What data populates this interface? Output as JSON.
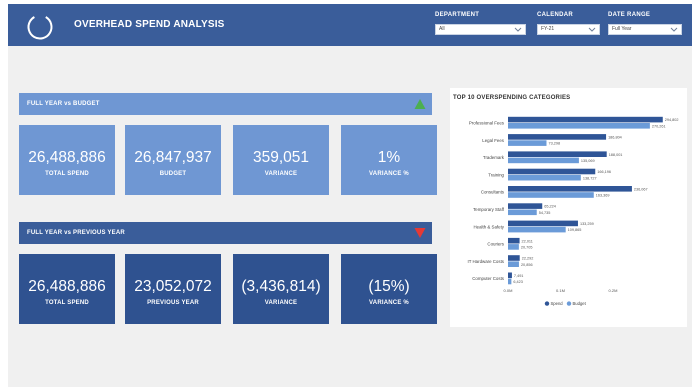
{
  "header": {
    "title": "OVERHEAD SPEND ANALYSIS",
    "filters": [
      {
        "label": "DEPARTMENT",
        "value": "All"
      },
      {
        "label": "CALENDAR",
        "value": "FY-21"
      },
      {
        "label": "DATE RANGE",
        "value": "Full Year"
      }
    ]
  },
  "sections": {
    "budget": {
      "title": "FULL YEAR vs BUDGET",
      "indicator": "up-arrow-green",
      "indicator_color": "#4caf50",
      "cards": [
        {
          "value": "26,488,886",
          "label": "TOTAL SPEND"
        },
        {
          "value": "26,847,937",
          "label": "BUDGET"
        },
        {
          "value": "359,051",
          "label": "VARIANCE"
        },
        {
          "value": "1%",
          "label": "VARIANCE %"
        }
      ]
    },
    "previous_year": {
      "title": "FULL YEAR vs PREVIOUS YEAR",
      "indicator": "down-arrow-red",
      "indicator_color": "#e53935",
      "cards": [
        {
          "value": "26,488,886",
          "label": "TOTAL SPEND"
        },
        {
          "value": "23,052,072",
          "label": "PREVIOUS YEAR"
        },
        {
          "value": "(3,436,814)",
          "label": "VARIANCE"
        },
        {
          "value": "(15%)",
          "label": "VARIANCE %"
        }
      ]
    }
  },
  "colors": {
    "header": "#3a5d9a",
    "light_card": "#6f97d3",
    "dark_card": "#2f5290",
    "spend": "#2f5597",
    "budget": "#6b9bd8"
  },
  "chart": {
    "title": "TOP 10 OVERSPENDING CATEGORIES"
  },
  "chart_data": {
    "type": "bar",
    "orientation": "horizontal",
    "title": "TOP 10 OVERSPENDING CATEGORIES",
    "categories": [
      "Professional Fees",
      "Legal Fees",
      "Trademark",
      "Training",
      "Consultants",
      "Temporary Staff",
      "Health & Safety",
      "Couriers",
      "IT Hardware Costs",
      "Computer Costs"
    ],
    "series": [
      {
        "name": "Spend",
        "values": [
          {
            "n": 294802,
            "t": "294,802"
          },
          {
            "n": 186804,
            "t": "186,804"
          },
          {
            "n": 188001,
            "t": "188,001"
          },
          {
            "n": 166196,
            "t": "166,196"
          },
          {
            "n": 236067,
            "t": "236,067"
          },
          {
            "n": 65224,
            "t": "65,224"
          },
          {
            "n": 133259,
            "t": "133,259"
          },
          {
            "n": 22011,
            "t": "22,011"
          },
          {
            "n": 22292,
            "t": "22,292"
          },
          {
            "n": 7491,
            "t": "7,491"
          }
        ]
      },
      {
        "name": "Budget",
        "values": [
          {
            "n": 270261,
            "t": "270,261"
          },
          {
            "n": 73298,
            "t": "73,298"
          },
          {
            "n": 135069,
            "t": "135,069"
          },
          {
            "n": 138727,
            "t": "138,727"
          },
          {
            "n": 163369,
            "t": "163,369"
          },
          {
            "n": 54735,
            "t": "54,735"
          },
          {
            "n": 109865,
            "t": "109,865"
          },
          {
            "n": 20705,
            "t": "20,705"
          },
          {
            "n": 20856,
            "t": "20,856"
          },
          {
            "n": 6423,
            "t": "6,423"
          }
        ]
      }
    ],
    "xticks": [
      {
        "v": 0,
        "label": "0.0M"
      },
      {
        "v": 100000,
        "label": "0.1M"
      },
      {
        "v": 200000,
        "label": "0.2M"
      }
    ],
    "xlim": [
      0,
      320000
    ],
    "legend": "bottom",
    "grid": false
  }
}
